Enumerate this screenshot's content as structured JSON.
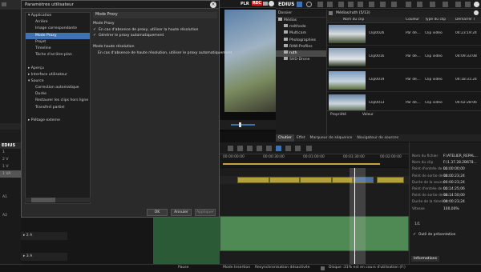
{
  "dialog": {
    "title": "Paramètres utilisateur",
    "close_icon": "close-icon",
    "tree": [
      {
        "label": "Application",
        "level": 0,
        "expanded": true
      },
      {
        "label": "Arrière",
        "level": 1
      },
      {
        "label": "Image correspondante",
        "level": 1
      },
      {
        "label": "Mode Proxy",
        "level": 1,
        "selected": true
      },
      {
        "label": "Projet",
        "level": 1
      },
      {
        "label": "Timeline",
        "level": 1
      },
      {
        "label": "Tâche d'arrière-plan",
        "level": 1
      },
      {
        "label": "",
        "level": 1
      },
      {
        "label": "Aperçu",
        "level": 0,
        "expanded": false
      },
      {
        "label": "Interface utilisateur",
        "level": 0,
        "expanded": false
      },
      {
        "label": "Source",
        "level": 0,
        "expanded": true
      },
      {
        "label": "Correction automatique",
        "level": 1
      },
      {
        "label": "Durée",
        "level": 1
      },
      {
        "label": "Restaurer les clips hors ligne",
        "level": 1
      },
      {
        "label": "Transfert partiel",
        "level": 1
      },
      {
        "label": "",
        "level": 1
      },
      {
        "label": "Piétage externe",
        "level": 0,
        "expanded": false
      }
    ],
    "section_title": "Mode Proxy",
    "proxy_group": "Mode Proxy",
    "opt1": "En cas d'absence de proxy, utiliser la haute résolution",
    "opt2": "Générer le proxy automatiquement",
    "hires_group": "Mode haute résolution",
    "hires_text": "En cas d'absence de haute résolution, utiliser le proxy automatiquement",
    "ok": "OK",
    "cancel": "Annuler",
    "apply": "Appliquer"
  },
  "player": {
    "label": "PLR",
    "rec": "REC"
  },
  "app": {
    "name": "EDIUS"
  },
  "bin": {
    "folder_label": "Dossier",
    "path": "Médias/ruth (5/13)",
    "tree": [
      "Médias",
      "méthode",
      "Multicam",
      "Photographies",
      "RAW-Profiles",
      "ruth",
      "SHD-Drone"
    ],
    "tree_selected": "ruth",
    "columns": [
      "Nom du clip",
      "Couleur",
      "Type du clip",
      "Démarrer T"
    ],
    "clips": [
      {
        "name": "Clip0026",
        "color": "Par dé...",
        "type": "Clip vidéo",
        "start": "04:23:19:24"
      },
      {
        "name": "Clip0016",
        "color": "Par dé...",
        "type": "Clip vidéo",
        "start": "04:09:33:08"
      },
      {
        "name": "Clip0019",
        "color": "Par dé...",
        "type": "Clip vidéo",
        "start": "04:18:31:24"
      },
      {
        "name": "Clip0013",
        "color": "Par dé...",
        "type": "Clip vidéo",
        "start": "04:02:28:06"
      }
    ],
    "prop_label": "Propriété",
    "value_label": "Valeur"
  },
  "tabs": [
    "Chutier",
    "Effet",
    "Marqueur de séquence",
    "Navigateur de sources"
  ],
  "tabs_active": "Chutier",
  "timeline": {
    "ruler": [
      "00:00:00:00",
      "00:00:30:00",
      "00:01:00:00",
      "00:01:30:00",
      "00:02:00:00"
    ],
    "tracks_left": [
      "1",
      "2 V",
      "1 V",
      "1 VA",
      "A1",
      "A2"
    ],
    "lower_tracks": [
      "2 A",
      "3 A"
    ]
  },
  "info": {
    "rows": [
      {
        "k": "Nom du fichier",
        "v": "F:\\ATELIER_REPAL..."
      },
      {
        "k": "Nom du clip",
        "v": "F:\\1.37.28.2B678..."
      },
      {
        "k": "Point d'entrée de la...",
        "v": "00:00:00;00"
      },
      {
        "k": "Point de sortie de la...",
        "v": "00:00:23;24"
      },
      {
        "k": "Durée de la source",
        "v": "00:00:23;24"
      },
      {
        "k": "Point d'entrée de la...",
        "v": "00:14:25;06"
      },
      {
        "k": "Point de sortie de la...",
        "v": "00:14:50;00"
      },
      {
        "k": "Durée de la timeline",
        "v": "00:00:23;24"
      },
      {
        "k": "Vitesse",
        "v": "100,00%"
      }
    ],
    "layers_count": "1/1",
    "outil": "Outil de présentation",
    "panel_label": "Informations"
  },
  "status": {
    "pause": "Pause",
    "mode": "Mode Insertion",
    "sync": "Resynchronisation désactivée",
    "disk": "Disque :31% est en cours d'utilisation (F:)"
  }
}
